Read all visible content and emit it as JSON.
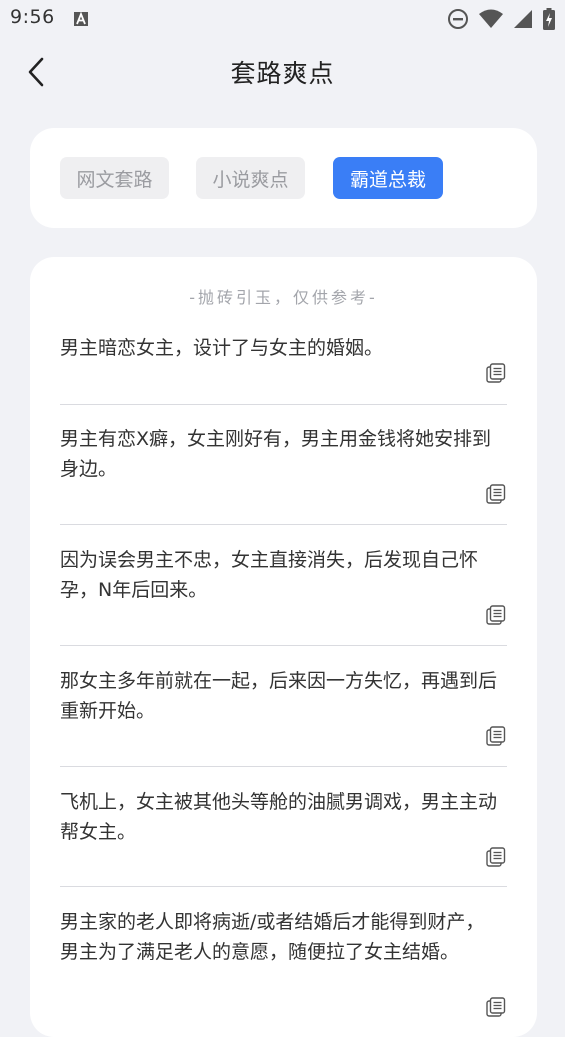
{
  "status": {
    "time": "9:56"
  },
  "header": {
    "title": "套路爽点"
  },
  "tabs": [
    {
      "label": "网文套路",
      "active": false
    },
    {
      "label": "小说爽点",
      "active": false
    },
    {
      "label": "霸道总裁",
      "active": true
    }
  ],
  "colors": {
    "accent": "#3a7ef6",
    "background": "#f1f2f6"
  },
  "hint": "-抛砖引玉，仅供参考-",
  "items": [
    {
      "text": "男主暗恋女主，设计了与女主的婚姻。"
    },
    {
      "text": "男主有恋X癖，女主刚好有，男主用金钱将她安排到身边。"
    },
    {
      "text": "因为误会男主不忠，女主直接消失，后发现自己怀孕，N年后回来。"
    },
    {
      "text": "那女主多年前就在一起，后来因一方失忆，再遇到后重新开始。"
    },
    {
      "text": "飞机上，女主被其他头等舱的油腻男调戏，男主主动帮女主。"
    },
    {
      "text": "男主家的老人即将病逝/或者结婚后才能得到财产，男主为了满足老人的意愿，随便拉了女主结婚。"
    }
  ]
}
